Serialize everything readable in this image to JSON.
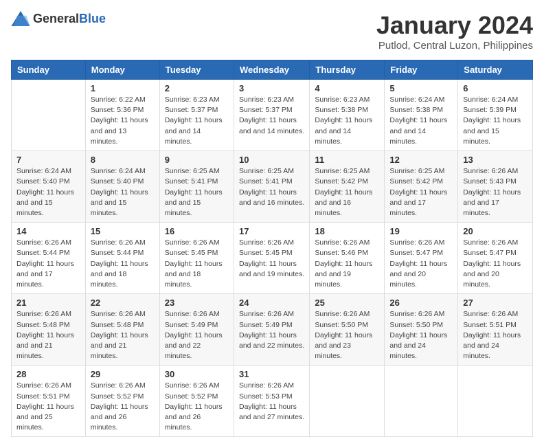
{
  "logo": {
    "text_general": "General",
    "text_blue": "Blue"
  },
  "title": "January 2024",
  "subtitle": "Putlod, Central Luzon, Philippines",
  "days_of_week": [
    "Sunday",
    "Monday",
    "Tuesday",
    "Wednesday",
    "Thursday",
    "Friday",
    "Saturday"
  ],
  "weeks": [
    [
      {
        "day": "",
        "sunrise": "",
        "sunset": "",
        "daylight": ""
      },
      {
        "day": "1",
        "sunrise": "Sunrise: 6:22 AM",
        "sunset": "Sunset: 5:36 PM",
        "daylight": "Daylight: 11 hours and 13 minutes."
      },
      {
        "day": "2",
        "sunrise": "Sunrise: 6:23 AM",
        "sunset": "Sunset: 5:37 PM",
        "daylight": "Daylight: 11 hours and 14 minutes."
      },
      {
        "day": "3",
        "sunrise": "Sunrise: 6:23 AM",
        "sunset": "Sunset: 5:37 PM",
        "daylight": "Daylight: 11 hours and 14 minutes."
      },
      {
        "day": "4",
        "sunrise": "Sunrise: 6:23 AM",
        "sunset": "Sunset: 5:38 PM",
        "daylight": "Daylight: 11 hours and 14 minutes."
      },
      {
        "day": "5",
        "sunrise": "Sunrise: 6:24 AM",
        "sunset": "Sunset: 5:38 PM",
        "daylight": "Daylight: 11 hours and 14 minutes."
      },
      {
        "day": "6",
        "sunrise": "Sunrise: 6:24 AM",
        "sunset": "Sunset: 5:39 PM",
        "daylight": "Daylight: 11 hours and 15 minutes."
      }
    ],
    [
      {
        "day": "7",
        "sunrise": "Sunrise: 6:24 AM",
        "sunset": "Sunset: 5:40 PM",
        "daylight": "Daylight: 11 hours and 15 minutes."
      },
      {
        "day": "8",
        "sunrise": "Sunrise: 6:24 AM",
        "sunset": "Sunset: 5:40 PM",
        "daylight": "Daylight: 11 hours and 15 minutes."
      },
      {
        "day": "9",
        "sunrise": "Sunrise: 6:25 AM",
        "sunset": "Sunset: 5:41 PM",
        "daylight": "Daylight: 11 hours and 15 minutes."
      },
      {
        "day": "10",
        "sunrise": "Sunrise: 6:25 AM",
        "sunset": "Sunset: 5:41 PM",
        "daylight": "Daylight: 11 hours and 16 minutes."
      },
      {
        "day": "11",
        "sunrise": "Sunrise: 6:25 AM",
        "sunset": "Sunset: 5:42 PM",
        "daylight": "Daylight: 11 hours and 16 minutes."
      },
      {
        "day": "12",
        "sunrise": "Sunrise: 6:25 AM",
        "sunset": "Sunset: 5:42 PM",
        "daylight": "Daylight: 11 hours and 17 minutes."
      },
      {
        "day": "13",
        "sunrise": "Sunrise: 6:26 AM",
        "sunset": "Sunset: 5:43 PM",
        "daylight": "Daylight: 11 hours and 17 minutes."
      }
    ],
    [
      {
        "day": "14",
        "sunrise": "Sunrise: 6:26 AM",
        "sunset": "Sunset: 5:44 PM",
        "daylight": "Daylight: 11 hours and 17 minutes."
      },
      {
        "day": "15",
        "sunrise": "Sunrise: 6:26 AM",
        "sunset": "Sunset: 5:44 PM",
        "daylight": "Daylight: 11 hours and 18 minutes."
      },
      {
        "day": "16",
        "sunrise": "Sunrise: 6:26 AM",
        "sunset": "Sunset: 5:45 PM",
        "daylight": "Daylight: 11 hours and 18 minutes."
      },
      {
        "day": "17",
        "sunrise": "Sunrise: 6:26 AM",
        "sunset": "Sunset: 5:45 PM",
        "daylight": "Daylight: 11 hours and 19 minutes."
      },
      {
        "day": "18",
        "sunrise": "Sunrise: 6:26 AM",
        "sunset": "Sunset: 5:46 PM",
        "daylight": "Daylight: 11 hours and 19 minutes."
      },
      {
        "day": "19",
        "sunrise": "Sunrise: 6:26 AM",
        "sunset": "Sunset: 5:47 PM",
        "daylight": "Daylight: 11 hours and 20 minutes."
      },
      {
        "day": "20",
        "sunrise": "Sunrise: 6:26 AM",
        "sunset": "Sunset: 5:47 PM",
        "daylight": "Daylight: 11 hours and 20 minutes."
      }
    ],
    [
      {
        "day": "21",
        "sunrise": "Sunrise: 6:26 AM",
        "sunset": "Sunset: 5:48 PM",
        "daylight": "Daylight: 11 hours and 21 minutes."
      },
      {
        "day": "22",
        "sunrise": "Sunrise: 6:26 AM",
        "sunset": "Sunset: 5:48 PM",
        "daylight": "Daylight: 11 hours and 21 minutes."
      },
      {
        "day": "23",
        "sunrise": "Sunrise: 6:26 AM",
        "sunset": "Sunset: 5:49 PM",
        "daylight": "Daylight: 11 hours and 22 minutes."
      },
      {
        "day": "24",
        "sunrise": "Sunrise: 6:26 AM",
        "sunset": "Sunset: 5:49 PM",
        "daylight": "Daylight: 11 hours and 22 minutes."
      },
      {
        "day": "25",
        "sunrise": "Sunrise: 6:26 AM",
        "sunset": "Sunset: 5:50 PM",
        "daylight": "Daylight: 11 hours and 23 minutes."
      },
      {
        "day": "26",
        "sunrise": "Sunrise: 6:26 AM",
        "sunset": "Sunset: 5:50 PM",
        "daylight": "Daylight: 11 hours and 24 minutes."
      },
      {
        "day": "27",
        "sunrise": "Sunrise: 6:26 AM",
        "sunset": "Sunset: 5:51 PM",
        "daylight": "Daylight: 11 hours and 24 minutes."
      }
    ],
    [
      {
        "day": "28",
        "sunrise": "Sunrise: 6:26 AM",
        "sunset": "Sunset: 5:51 PM",
        "daylight": "Daylight: 11 hours and 25 minutes."
      },
      {
        "day": "29",
        "sunrise": "Sunrise: 6:26 AM",
        "sunset": "Sunset: 5:52 PM",
        "daylight": "Daylight: 11 hours and 26 minutes."
      },
      {
        "day": "30",
        "sunrise": "Sunrise: 6:26 AM",
        "sunset": "Sunset: 5:52 PM",
        "daylight": "Daylight: 11 hours and 26 minutes."
      },
      {
        "day": "31",
        "sunrise": "Sunrise: 6:26 AM",
        "sunset": "Sunset: 5:53 PM",
        "daylight": "Daylight: 11 hours and 27 minutes."
      },
      {
        "day": "",
        "sunrise": "",
        "sunset": "",
        "daylight": ""
      },
      {
        "day": "",
        "sunrise": "",
        "sunset": "",
        "daylight": ""
      },
      {
        "day": "",
        "sunrise": "",
        "sunset": "",
        "daylight": ""
      }
    ]
  ]
}
